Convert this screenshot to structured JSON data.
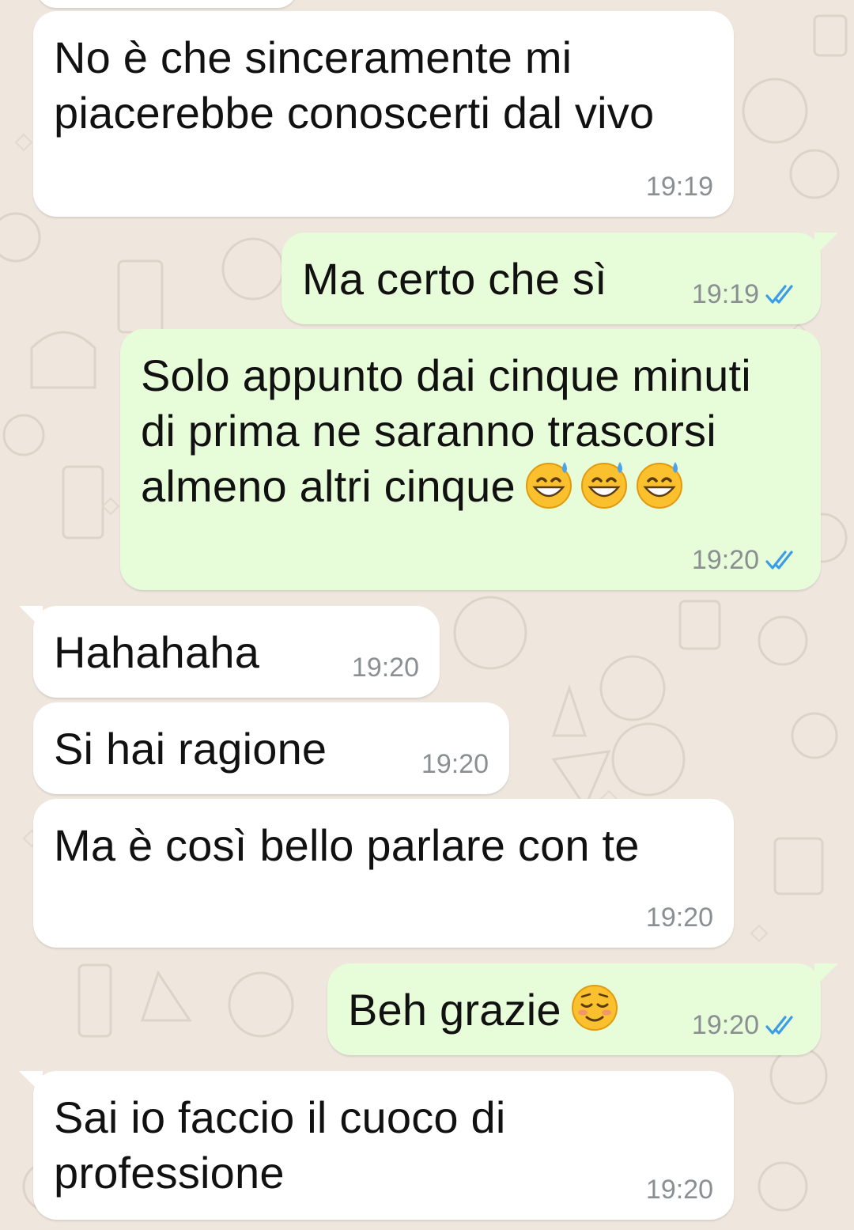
{
  "colors": {
    "background": "#efe7de",
    "incoming_bubble": "#ffffff",
    "outgoing_bubble": "#e7fcd8",
    "timestamp": "#8a8f92",
    "read_ticks": "#3b9ce8"
  },
  "messages": [
    {
      "direction": "incoming",
      "text": "No è che sinceramente mi\npiacerebbe conoscerti dal vivo",
      "time": "19:19"
    },
    {
      "direction": "outgoing",
      "text": "Ma certo che sì",
      "time": "19:19",
      "status": "read"
    },
    {
      "direction": "outgoing",
      "text": "Solo appunto dai cinque minuti\ndi prima ne saranno trascorsi\nalmeno altri cinque",
      "emoji": [
        "grinning-sweat-emoji",
        "grinning-sweat-emoji",
        "grinning-sweat-emoji"
      ],
      "time": "19:20",
      "status": "read"
    },
    {
      "direction": "incoming",
      "text": "Hahahaha",
      "time": "19:20"
    },
    {
      "direction": "incoming",
      "text": "Si hai ragione",
      "time": "19:20"
    },
    {
      "direction": "incoming",
      "text": "Ma è così bello parlare con te",
      "time": "19:20"
    },
    {
      "direction": "outgoing",
      "text": "Beh grazie",
      "emoji": [
        "smiling-blush-emoji"
      ],
      "time": "19:20",
      "status": "read"
    },
    {
      "direction": "incoming",
      "text": "Sai io faccio il cuoco di\nprofessione",
      "time": "19:20"
    }
  ]
}
